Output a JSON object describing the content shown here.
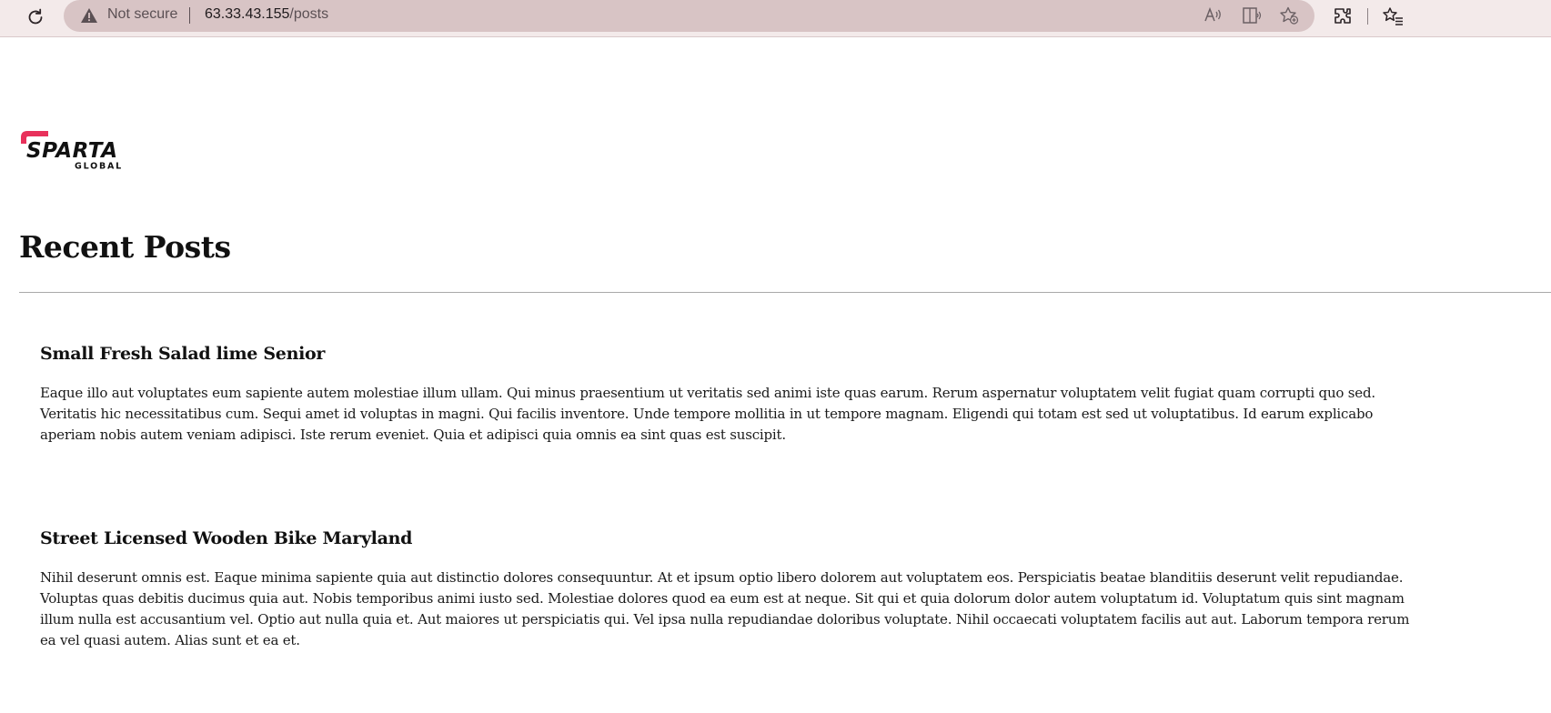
{
  "browser": {
    "security_label": "Not secure",
    "url_host": "63.33.43.155",
    "url_path": "/posts",
    "icons": {
      "reload": "reload-icon",
      "warning": "warning-icon",
      "read_aloud": "read-aloud-icon",
      "immersive_reader": "immersive-reader-icon",
      "add_favorite": "add-favorite-icon",
      "extensions": "extensions-icon",
      "favorites": "favorites-icon"
    }
  },
  "brand": {
    "name": "SPARTA",
    "tagline": "GLOBAL",
    "accent_color": "#e8315b"
  },
  "page": {
    "title": "Recent Posts"
  },
  "posts": [
    {
      "title": "Small Fresh Salad lime Senior",
      "body": "Eaque illo aut voluptates eum sapiente autem molestiae illum ullam. Qui minus praesentium ut veritatis sed animi iste quas earum. Rerum aspernatur voluptatem velit fugiat quam corrupti quo sed. Veritatis hic necessitatibus cum. Sequi amet id voluptas in magni. Qui facilis inventore. Unde tempore mollitia in ut tempore magnam. Eligendi qui totam est sed ut voluptatibus. Id earum explicabo aperiam nobis autem veniam adipisci. Iste rerum eveniet. Quia et adipisci quia omnis ea sint quas est suscipit."
    },
    {
      "title": "Street Licensed Wooden Bike Maryland",
      "body": "Nihil deserunt omnis est. Eaque minima sapiente quia aut distinctio dolores consequuntur. At et ipsum optio libero dolorem aut voluptatem eos. Perspiciatis beatae blanditiis deserunt velit repudiandae. Voluptas quas debitis ducimus quia aut. Nobis temporibus animi iusto sed. Molestiae dolores quod ea eum est at neque. Sit qui et quia dolorum dolor autem voluptatum id. Voluptatum quis sint magnam illum nulla est accusantium vel. Optio aut nulla quia et. Aut maiores ut perspiciatis qui. Vel ipsa nulla repudiandae doloribus voluptate. Nihil occaecati voluptatem facilis aut aut. Laborum tempora rerum ea vel quasi autem. Alias sunt et ea et."
    }
  ]
}
